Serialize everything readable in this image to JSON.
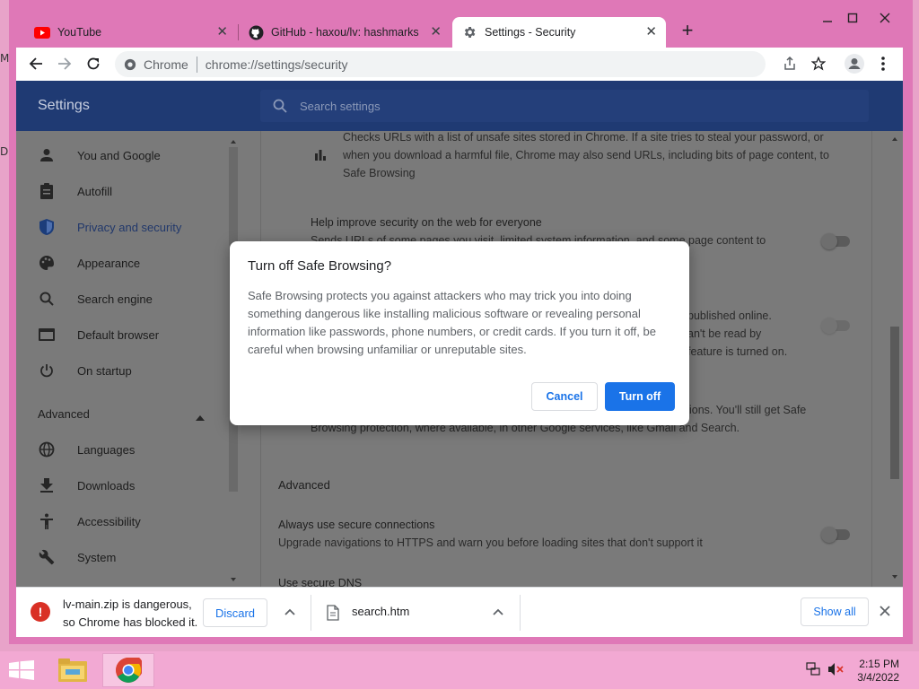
{
  "desktop": {
    "left_icon_letters": [
      "M",
      "D"
    ]
  },
  "window": {
    "controls": {
      "minimize": "–",
      "maximize": "☐",
      "close": "✕"
    }
  },
  "tabs": [
    {
      "title": "YouTube",
      "icon": "youtube-icon",
      "active": false
    },
    {
      "title": "GitHub - haxou/lv: hashmarks",
      "icon": "github-icon",
      "active": false
    },
    {
      "title": "Settings - Security",
      "icon": "gear-icon",
      "active": true
    }
  ],
  "toolbar": {
    "site_label": "Chrome",
    "url": "chrome://settings/security"
  },
  "settings": {
    "title": "Settings",
    "search_placeholder": "Search settings"
  },
  "sidebar": {
    "items": [
      {
        "label": "You and Google",
        "icon": "person-icon",
        "selected": false
      },
      {
        "label": "Autofill",
        "icon": "clipboard-icon",
        "selected": false
      },
      {
        "label": "Privacy and security",
        "icon": "shield-icon",
        "selected": true
      },
      {
        "label": "Appearance",
        "icon": "palette-icon",
        "selected": false
      },
      {
        "label": "Search engine",
        "icon": "search-icon",
        "selected": false
      },
      {
        "label": "Default browser",
        "icon": "browser-icon",
        "selected": false
      },
      {
        "label": "On startup",
        "icon": "power-icon",
        "selected": false
      }
    ],
    "advanced_label": "Advanced",
    "advanced_items": [
      {
        "label": "Languages",
        "icon": "globe-icon"
      },
      {
        "label": "Downloads",
        "icon": "download-icon"
      },
      {
        "label": "Accessibility",
        "icon": "accessibility-icon"
      },
      {
        "label": "System",
        "icon": "wrench-icon"
      }
    ]
  },
  "main": {
    "standard_desc_1": "Checks URLs with a list of unsafe sites stored in Chrome. If a site tries to steal your password, or",
    "standard_desc_2": "when you download a harmful file, Chrome may also send URLs, including bits of page content, to",
    "standard_desc_3": "Safe Browsing",
    "help_improve_title": "Help improve security on the web for everyone",
    "help_improve_desc": "Sends URLs of some pages you visit, limited system information, and some page content to",
    "right_frag_1": "published online.",
    "right_frag_2": "an't be read by",
    "right_frag_3": "feature is turned on.",
    "no_protection_frag_1": "ions. You'll still get Safe",
    "no_protection_frag_2": "Browsing protection, where available, in other Google services, like Gmail and Search.",
    "advanced_header": "Advanced",
    "secure_conn_title": "Always use secure connections",
    "secure_conn_desc": "Upgrade navigations to HTTPS and warn you before loading sites that don't support it",
    "secure_dns_title": "Use secure DNS"
  },
  "dialog": {
    "title": "Turn off Safe Browsing?",
    "body": "Safe Browsing protects you against attackers who may trick you into doing something dangerous like installing malicious software or revealing personal information like passwords, phone numbers, or credit cards. If you turn it off, be careful when browsing unfamiliar or unreputable sites.",
    "cancel_label": "Cancel",
    "confirm_label": "Turn off"
  },
  "downloads": {
    "item1_line1": "lv-main.zip is dangerous,",
    "item1_line2": "so Chrome has blocked it.",
    "discard_label": "Discard",
    "item2_name": "search.htm",
    "show_all_label": "Show all"
  },
  "taskbar": {
    "time": "2:15 PM",
    "date": "3/4/2022"
  },
  "colors": {
    "accent": "#1a73e8",
    "frame": "#df78b7",
    "header": "#1f3a73",
    "danger": "#d93025"
  }
}
